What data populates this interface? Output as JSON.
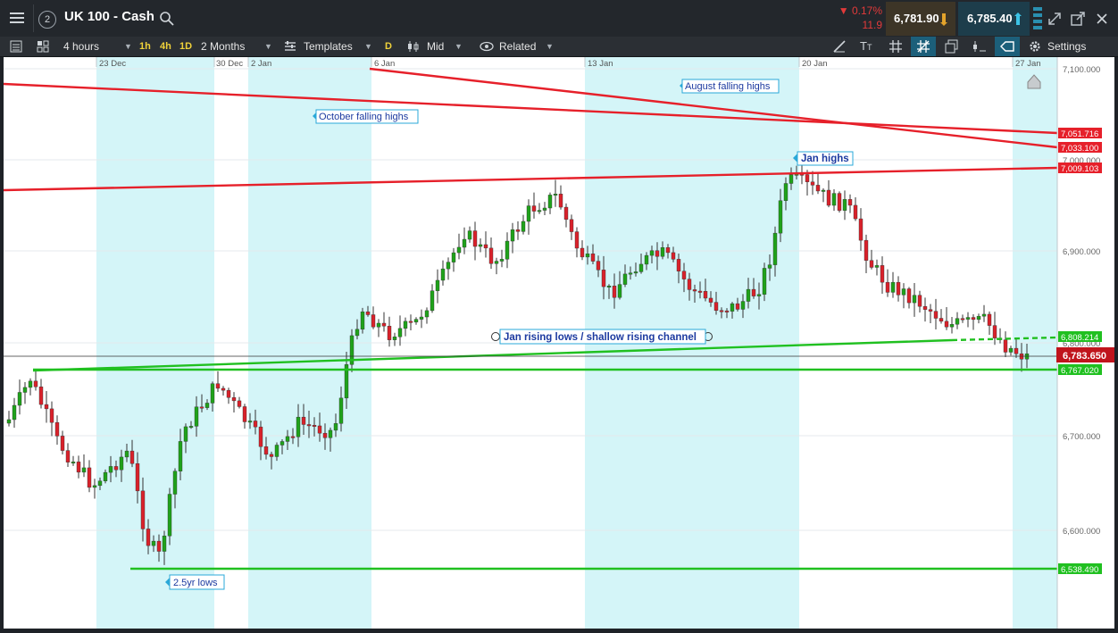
{
  "topbar": {
    "window_badge": "2",
    "title": "UK 100 - Cash",
    "change_pct": "▼ 0.17%",
    "change_pts": "11.9",
    "sell_price": "6,781.90",
    "buy_price": "6,785.40"
  },
  "toolbar": {
    "interval": "4 hours",
    "quick_intervals": [
      "1h",
      "4h",
      "1D"
    ],
    "period": "2 Months",
    "templates": "Templates",
    "d_badge": "D",
    "price_mode": "Mid",
    "related": "Related",
    "settings": "Settings"
  },
  "chart": {
    "date_labels": [
      "23 Dec",
      "30 Dec",
      "2 Jan",
      "6 Jan",
      "13 Jan",
      "20 Jan",
      "27 Jan"
    ],
    "y_ticks": [
      "7,100.000",
      "7,000.000",
      "6,900.000",
      "6,800.000",
      "6,700.000",
      "6,600.000"
    ],
    "price_tags": [
      "7,051.716",
      "7,033.100",
      "7,009.103",
      "6,808.214",
      "6,783.650",
      "6,767.020",
      "6,538.490"
    ],
    "annotations": {
      "august": "August falling highs",
      "october": "October falling highs",
      "jan_highs": "Jan highs",
      "channel": "Jan rising lows / shallow rising channel",
      "lows": "2.5yr lows"
    },
    "colors": {
      "up": "#1fa21a",
      "down": "#d9212a",
      "resistance": "#e6202a",
      "support": "#20c020",
      "highlight": "#d4f5f8"
    }
  }
}
